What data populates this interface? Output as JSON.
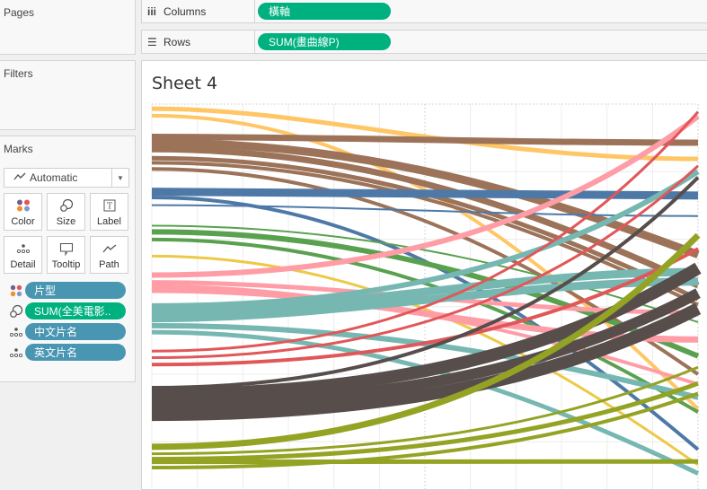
{
  "left_panel": {
    "pages_title": "Pages",
    "filters_title": "Filters",
    "marks_title": "Marks",
    "mark_type": "Automatic",
    "mark_buttons": [
      {
        "label": "Color",
        "icon": "color-dots-icon"
      },
      {
        "label": "Size",
        "icon": "size-icon"
      },
      {
        "label": "Label",
        "icon": "label-icon"
      },
      {
        "label": "Detail",
        "icon": "detail-icon"
      },
      {
        "label": "Tooltip",
        "icon": "tooltip-icon"
      },
      {
        "label": "Path",
        "icon": "path-icon"
      }
    ],
    "mark_fields": [
      {
        "label": "片型",
        "encoding": "color",
        "pill_color": "blue"
      },
      {
        "label": "SUM(全美電影..",
        "encoding": "size",
        "pill_color": "green"
      },
      {
        "label": "中文片名",
        "encoding": "detail",
        "pill_color": "blue"
      },
      {
        "label": "英文片名",
        "encoding": "detail",
        "pill_color": "blue"
      }
    ]
  },
  "shelves": {
    "columns_label": "Columns",
    "columns_pill": "橫軸",
    "rows_label": "Rows",
    "rows_pill": "SUM(畫曲線P)"
  },
  "sheet": {
    "title": "Sheet 4"
  },
  "colors": {
    "pill_green": "#00b180",
    "pill_blue": "#4996b2",
    "palette": {
      "yellow_orange": "#ffc666",
      "brown": "#9c7359",
      "blue": "#4e79a7",
      "green": "#59a14f",
      "gold": "#edc948",
      "pink": "#ff9da7",
      "teal": "#76b7b2",
      "red": "#e15759",
      "dark_gray": "#574e4c",
      "olive": "#94a323"
    }
  },
  "chart_data": {
    "type": "line",
    "title": "Sheet 4",
    "xlabel": "",
    "ylabel": "",
    "x_field": "橫軸",
    "y_field": "SUM(畫曲線P)",
    "xlim": [
      0,
      12
    ],
    "ylim": [
      0,
      100
    ],
    "grid": true,
    "axis_labels_visible": false,
    "note": "Curved path lines from left (x=0) to right (x=12); y values in normalized axis units (100=top, 0=bottom). Width = size (SUM 全美電影票房) relative weight.",
    "series": [
      {
        "name": "yellow-1",
        "color": "yellow_orange",
        "y_start": 98.8,
        "y_end": 85.8,
        "curve": "late",
        "weight": 5
      },
      {
        "name": "yellow-2",
        "color": "yellow_orange",
        "y_start": 97.0,
        "y_end": 21.0,
        "curve": "mid",
        "weight": 4
      },
      {
        "name": "brown-1",
        "color": "brown",
        "y_start": 91.5,
        "y_end": 90.0,
        "curve": "flat",
        "weight": 7
      },
      {
        "name": "brown-2",
        "color": "brown",
        "y_start": 90.0,
        "y_end": 61.0,
        "curve": "mid",
        "weight": 9
      },
      {
        "name": "brown-3",
        "color": "brown",
        "y_start": 88.3,
        "y_end": 53.0,
        "curve": "mid",
        "weight": 7
      },
      {
        "name": "brown-4",
        "color": "brown",
        "y_start": 86.0,
        "y_end": 49.5,
        "curve": "mid",
        "weight": 5
      },
      {
        "name": "brown-5",
        "color": "brown",
        "y_start": 84.8,
        "y_end": 48.0,
        "curve": "mid",
        "weight": 4
      },
      {
        "name": "brown-6",
        "color": "brown",
        "y_start": 83.2,
        "y_end": 30.0,
        "curve": "mid",
        "weight": 4
      },
      {
        "name": "blue-1",
        "color": "blue",
        "y_start": 77.3,
        "y_end": 76.3,
        "curve": "flat",
        "weight": 9
      },
      {
        "name": "blue-2",
        "color": "blue",
        "y_start": 75.8,
        "y_end": 10.5,
        "curve": "mid",
        "weight": 4
      },
      {
        "name": "blue-3",
        "color": "blue",
        "y_start": 73.8,
        "y_end": 71.0,
        "curve": "flat",
        "weight": 2
      },
      {
        "name": "green-1",
        "color": "green",
        "y_start": 68.5,
        "y_end": 43.5,
        "curve": "mid",
        "weight": 2
      },
      {
        "name": "green-2",
        "color": "green",
        "y_start": 66.9,
        "y_end": 34.7,
        "curve": "mid",
        "weight": 6
      },
      {
        "name": "green-3",
        "color": "green",
        "y_start": 64.9,
        "y_end": 20.2,
        "curve": "mid",
        "weight": 4
      },
      {
        "name": "gold-1",
        "color": "gold",
        "y_start": 60.6,
        "y_end": 6.5,
        "curve": "mid",
        "weight": 3
      },
      {
        "name": "pink-1",
        "color": "pink",
        "y_start": 55.7,
        "y_end": 96.8,
        "curve": "early",
        "weight": 6
      },
      {
        "name": "pink-2",
        "color": "pink",
        "y_start": 53.8,
        "y_end": 46.0,
        "curve": "flat",
        "weight": 5
      },
      {
        "name": "pink-3",
        "color": "pink",
        "y_start": 52.5,
        "y_end": 39.0,
        "curve": "flat",
        "weight": 7
      },
      {
        "name": "pink-4",
        "color": "pink",
        "y_start": 51.5,
        "y_end": 27.4,
        "curve": "mid",
        "weight": 4
      },
      {
        "name": "teal-1",
        "color": "teal",
        "y_start": 47.7,
        "y_end": 82.5,
        "curve": "early",
        "weight": 6
      },
      {
        "name": "teal-2",
        "color": "teal",
        "y_start": 46.2,
        "y_end": 56.5,
        "curve": "flat",
        "weight": 9
      },
      {
        "name": "teal-3",
        "color": "teal",
        "y_start": 44.5,
        "y_end": 54.0,
        "curve": "flat",
        "weight": 9
      },
      {
        "name": "teal-4",
        "color": "teal",
        "y_start": 42.6,
        "y_end": 24.0,
        "curve": "mid",
        "weight": 6
      },
      {
        "name": "teal-5",
        "color": "teal",
        "y_start": 40.9,
        "y_end": 4.3,
        "curve": "mid",
        "weight": 5
      },
      {
        "name": "red-1",
        "color": "red",
        "y_start": 36.0,
        "y_end": 98.0,
        "curve": "early",
        "weight": 3
      },
      {
        "name": "red-2",
        "color": "red",
        "y_start": 34.3,
        "y_end": 84.0,
        "curve": "early",
        "weight": 3
      },
      {
        "name": "red-3",
        "color": "red",
        "y_start": 32.5,
        "y_end": 62.5,
        "curve": "early",
        "weight": 4
      },
      {
        "name": "darkgray-1",
        "color": "dark_gray",
        "y_start": 26.5,
        "y_end": 81.0,
        "curve": "early",
        "weight": 4
      },
      {
        "name": "darkgray-2",
        "color": "dark_gray",
        "y_start": 24.8,
        "y_end": 57.5,
        "curve": "early",
        "weight": 14
      },
      {
        "name": "darkgray-3",
        "color": "dark_gray",
        "y_start": 22.3,
        "y_end": 51.0,
        "curve": "early",
        "weight": 12
      },
      {
        "name": "darkgray-4",
        "color": "dark_gray",
        "y_start": 19.5,
        "y_end": 47.0,
        "curve": "early",
        "weight": 14
      },
      {
        "name": "olive-1",
        "color": "olive",
        "y_start": 11.2,
        "y_end": 66.0,
        "curve": "early",
        "weight": 7
      },
      {
        "name": "olive-2",
        "color": "olive",
        "y_start": 9.4,
        "y_end": 31.8,
        "curve": "early",
        "weight": 3
      },
      {
        "name": "olive-3",
        "color": "olive",
        "y_start": 8.0,
        "y_end": 27.6,
        "curve": "early",
        "weight": 5
      },
      {
        "name": "olive-4",
        "color": "olive",
        "y_start": 7.3,
        "y_end": 7.4,
        "curve": "flat",
        "weight": 5
      },
      {
        "name": "olive-5",
        "color": "olive",
        "y_start": 5.8,
        "y_end": 25.0,
        "curve": "early",
        "weight": 4
      }
    ]
  }
}
